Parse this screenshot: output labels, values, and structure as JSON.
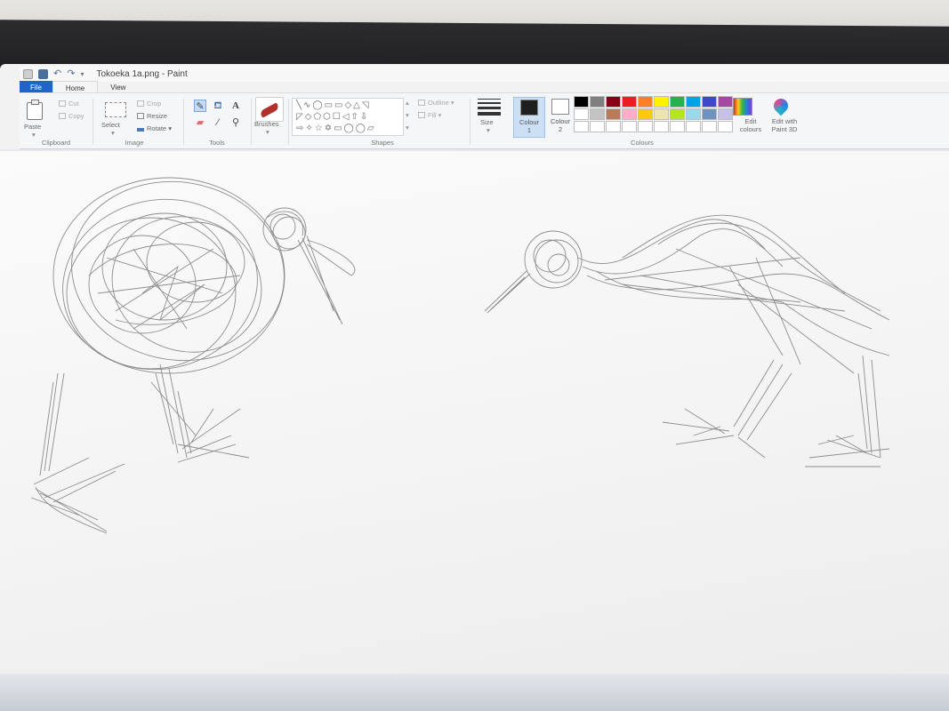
{
  "window": {
    "title": "Tokoeka 1a.png - Paint",
    "quick_access": [
      "save-icon",
      "undo-icon",
      "redo-icon"
    ]
  },
  "tabs": [
    {
      "label": "File"
    },
    {
      "label": "Home"
    },
    {
      "label": "View"
    }
  ],
  "ribbon": {
    "clipboard": {
      "paste": "Paste",
      "cut": "Cut",
      "copy": "Copy",
      "label": "Clipboard"
    },
    "image": {
      "select": "Select",
      "crop": "Crop",
      "resize": "Resize",
      "rotate": "Rotate",
      "label": "Image"
    },
    "tools": {
      "label": "Tools",
      "icons": [
        "pencil-icon",
        "fill-icon",
        "text-icon",
        "eraser-icon",
        "color-picker-icon",
        "magnifier-icon"
      ]
    },
    "brushes": {
      "label": "Brushes"
    },
    "shapes": {
      "outline": "Outline",
      "fill": "Fill",
      "label": "Shapes"
    },
    "size": {
      "label": "Size"
    },
    "colours": {
      "colour1": "Colour",
      "colour1_num": "1",
      "colour2": "Colour",
      "colour2_num": "2",
      "edit_colours": "Edit colours",
      "edit_with_paint3d": "Edit with Paint 3D",
      "label": "Colours",
      "colour1_value": "#1f1f1f",
      "colour2_value": "#ffffff",
      "palette": [
        "#000000",
        "#7f7f7f",
        "#880015",
        "#ed1c24",
        "#ff7f27",
        "#fff200",
        "#22b14c",
        "#00a2e8",
        "#3f48cc",
        "#a349a4",
        "#ffffff",
        "#c3c3c3",
        "#b97a57",
        "#ffaec9",
        "#ffc90e",
        "#efe4b0",
        "#b5e61d",
        "#99d9ea",
        "#7092be",
        "#c8bfe7",
        "#ffffff",
        "#ffffff",
        "#ffffff",
        "#ffffff",
        "#ffffff",
        "#ffffff",
        "#ffffff",
        "#ffffff",
        "#ffffff",
        "#ffffff"
      ]
    }
  },
  "canvas": {
    "content": "pencil sketch of two kiwi birds"
  }
}
